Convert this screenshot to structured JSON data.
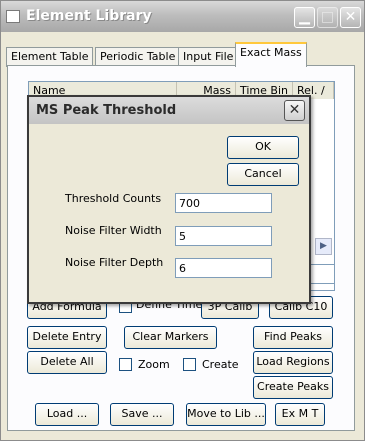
{
  "window": {
    "title": "Element Library"
  },
  "tabs": [
    "Element Table",
    "Periodic Table",
    "Input File",
    "Exact Mass"
  ],
  "list": {
    "columns": [
      "Name",
      "Mass",
      "Time Bin",
      "Rel. /"
    ]
  },
  "buttons": {
    "add_formula": "Add Formula",
    "define_time": "Define Time",
    "three_p_calib": "3P Calib",
    "calib_c10": "Calib C10",
    "delete_entry": "Delete Entry",
    "clear_markers": "Clear Markers",
    "find_peaks": "Find Peaks",
    "delete_all": "Delete All",
    "zoom": "Zoom",
    "create": "Create",
    "load_regions": "Load Regions",
    "create_peaks": "Create Peaks",
    "load": "Load ...",
    "save": "Save ...",
    "move_to_lib": "Move to Lib ...",
    "ex_m_t": "Ex M T"
  },
  "dialog": {
    "title": "MS Peak Threshold",
    "ok": "OK",
    "cancel": "Cancel",
    "fields": [
      {
        "label": "Threshold Counts",
        "value": "700"
      },
      {
        "label": "Noise Filter Width",
        "value": "5"
      },
      {
        "label": "Noise Filter Depth",
        "value": "6"
      }
    ]
  },
  "icons": {
    "close": "close-icon",
    "minimize": "minimize-icon",
    "maximize": "maximize-icon",
    "scroll_right": "arrow-right-icon"
  }
}
